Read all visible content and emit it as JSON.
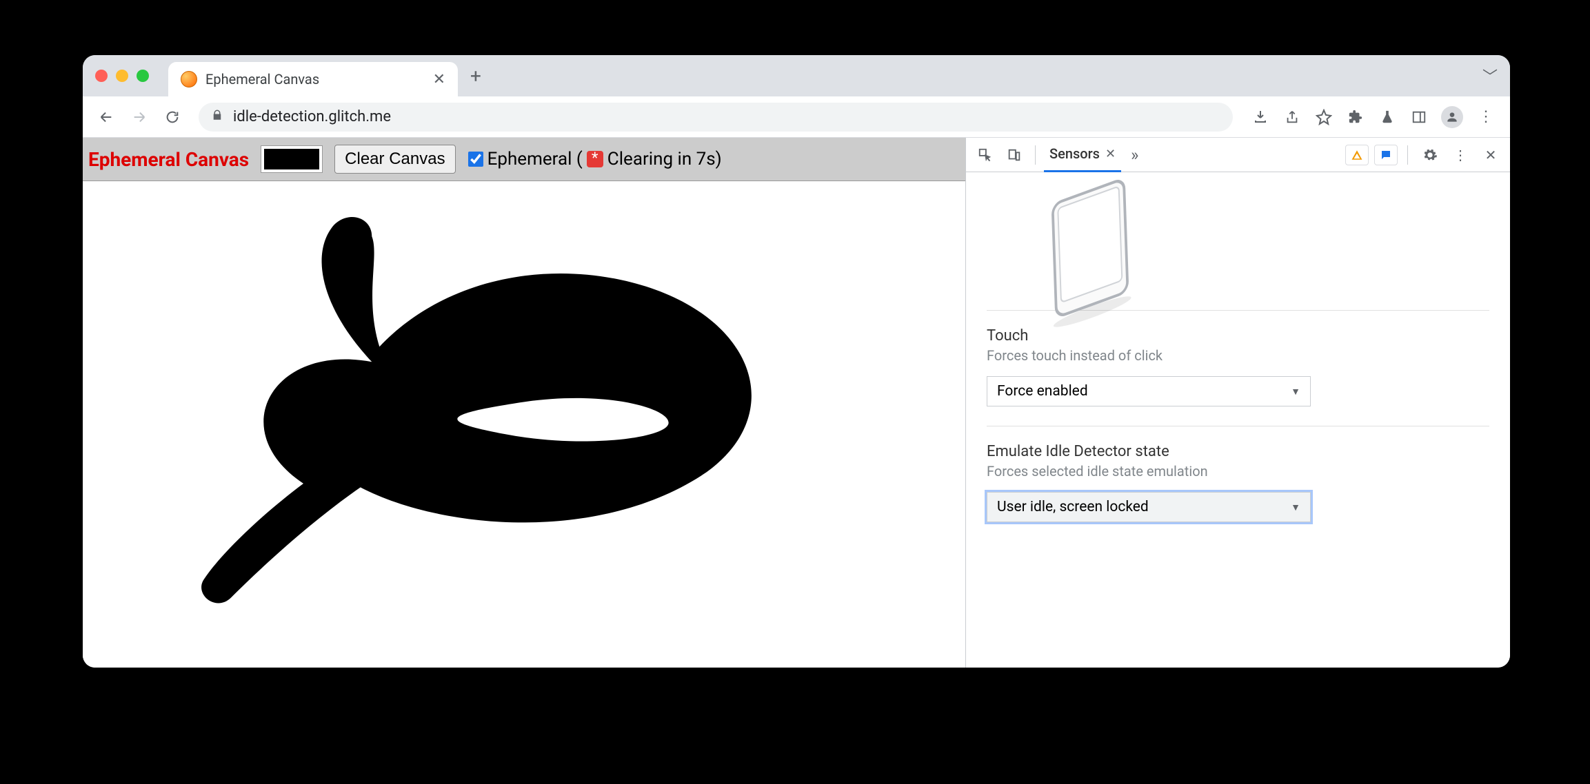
{
  "browser": {
    "tab": {
      "title": "Ephemeral Canvas"
    },
    "url": "idle-detection.glitch.me"
  },
  "page": {
    "title": "Ephemeral Canvas",
    "clear_button": "Clear Canvas",
    "ephemeral_label_prefix": "Ephemeral (",
    "ephemeral_label_suffix": " Clearing in 7s)",
    "ephemeral_checked": true,
    "color": "#000000"
  },
  "devtools": {
    "active_tab": "Sensors",
    "touch": {
      "title": "Touch",
      "subtitle": "Forces touch instead of click",
      "value": "Force enabled"
    },
    "idle": {
      "title": "Emulate Idle Detector state",
      "subtitle": "Forces selected idle state emulation",
      "value": "User idle, screen locked"
    }
  }
}
